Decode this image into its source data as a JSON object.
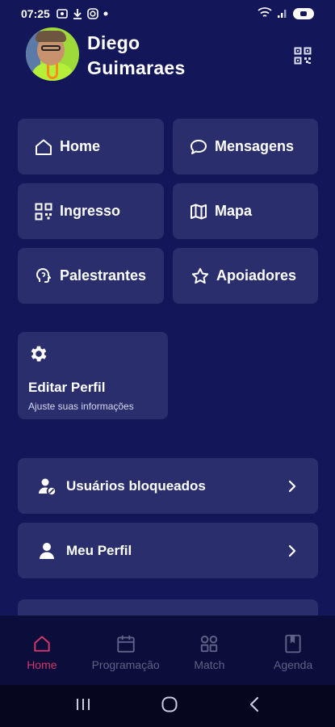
{
  "status_bar": {
    "time": "07:25"
  },
  "profile": {
    "first_name": "Diego",
    "last_name": "Guimaraes"
  },
  "grid": [
    {
      "label": "Home",
      "icon": "home-icon"
    },
    {
      "label": "Mensagens",
      "icon": "message-icon"
    },
    {
      "label": "Ingresso",
      "icon": "qr-code-icon"
    },
    {
      "label": "Mapa",
      "icon": "map-icon"
    },
    {
      "label": "Palestrantes",
      "icon": "speaker-icon"
    },
    {
      "label": "Apoiadores",
      "icon": "star-icon"
    }
  ],
  "edit_profile": {
    "title": "Editar Perfil",
    "subtitle": "Ajuste suas informações",
    "icon": "gear-icon"
  },
  "list": [
    {
      "label": "Usuários bloqueados",
      "icon": "blocked-user-icon"
    },
    {
      "label": "Meu Perfil",
      "icon": "user-icon"
    }
  ],
  "bottom_nav": [
    {
      "label": "Home",
      "icon": "home-icon",
      "active": true
    },
    {
      "label": "Programação",
      "icon": "calendar-icon"
    },
    {
      "label": "Match",
      "icon": "grid-icon"
    },
    {
      "label": "Agenda",
      "icon": "bookmark-icon"
    }
  ],
  "colors": {
    "background": "#13175a",
    "card": "#2a2e6d",
    "active": "#d1396a",
    "inactive": "#5d6286"
  }
}
